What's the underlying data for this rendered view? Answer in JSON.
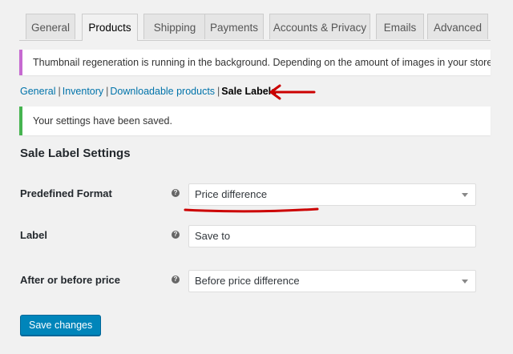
{
  "tabs": [
    {
      "label": "General",
      "active": false
    },
    {
      "label": "Products",
      "active": true
    },
    {
      "label": "Shipping",
      "active": false
    },
    {
      "label": "Payments",
      "active": false
    },
    {
      "label": "Accounts & Privacy",
      "active": false
    },
    {
      "label": "Emails",
      "active": false
    },
    {
      "label": "Advanced",
      "active": false
    }
  ],
  "notice_info": {
    "text": "Thumbnail regeneration is running in the background. Depending on the amount of images in your store this m"
  },
  "subnav": {
    "items": [
      {
        "label": "General"
      },
      {
        "label": "Inventory"
      },
      {
        "label": "Downloadable products"
      },
      {
        "label": "Sale Labels",
        "current": true
      }
    ],
    "separator": "|"
  },
  "notice_success": {
    "text": "Your settings have been saved."
  },
  "section": {
    "title": "Sale Label Settings"
  },
  "fields": [
    {
      "label": "Predefined Format",
      "type": "select",
      "value": "Price difference",
      "help": "?"
    },
    {
      "label": "Label",
      "type": "text",
      "value": "Save to",
      "help": "?"
    },
    {
      "label": "After or before price",
      "type": "select",
      "value": "Before price difference",
      "help": "?"
    }
  ],
  "save_button": {
    "label": "Save changes"
  },
  "colors": {
    "accent": "#0085ba",
    "annotation": "#cc0000",
    "success": "#46b450",
    "info": "#c66ad1",
    "link": "#0073aa"
  }
}
